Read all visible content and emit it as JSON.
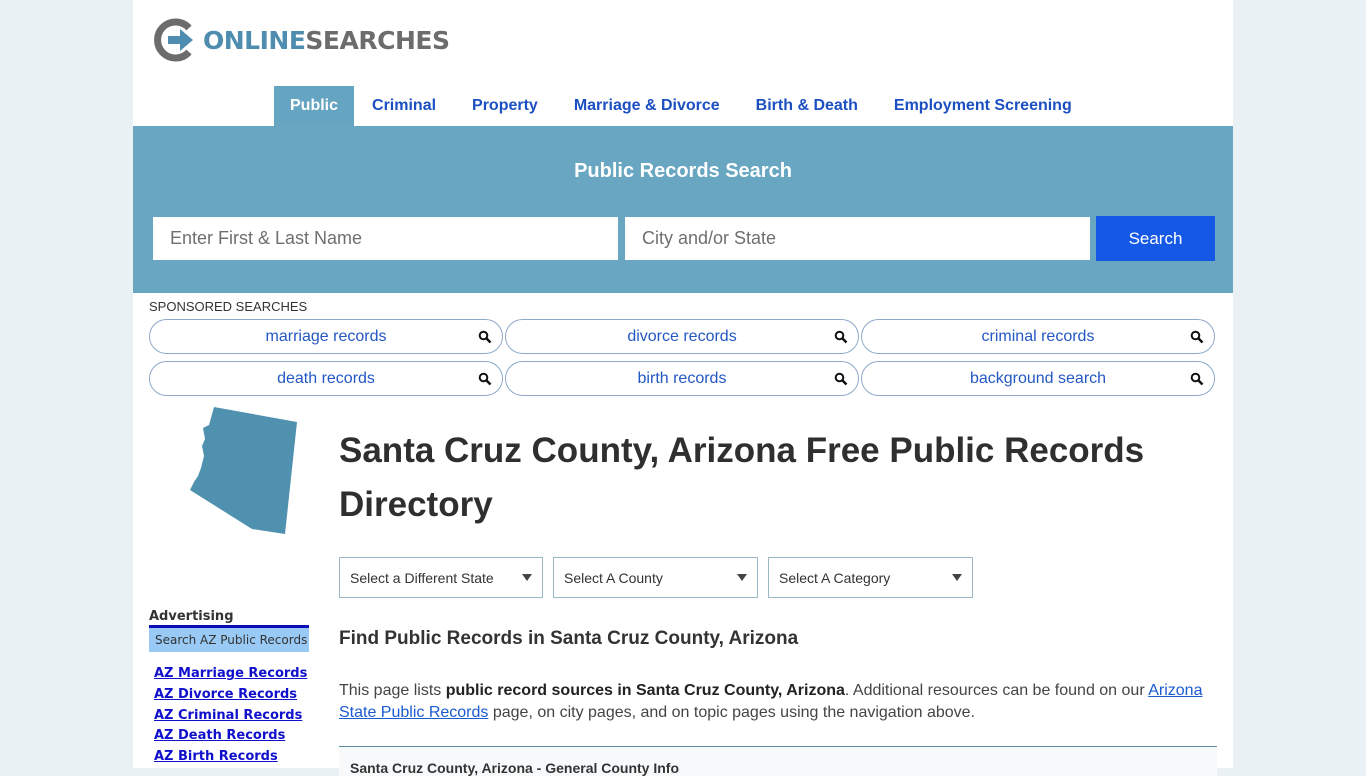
{
  "brand": {
    "part1": "ONLINE",
    "part2": "SEARCHES"
  },
  "nav": {
    "items": [
      {
        "label": "Public",
        "active": true
      },
      {
        "label": "Criminal"
      },
      {
        "label": "Property"
      },
      {
        "label": "Marriage & Divorce"
      },
      {
        "label": "Birth & Death"
      },
      {
        "label": "Employment Screening"
      }
    ]
  },
  "hero": {
    "title": "Public Records Search",
    "name_placeholder": "Enter First & Last Name",
    "location_placeholder": "City and/or State",
    "search_label": "Search"
  },
  "sponsored": {
    "label": "SPONSORED SEARCHES",
    "items": [
      "marriage records",
      "divorce records",
      "criminal records",
      "death records",
      "birth records",
      "background search"
    ]
  },
  "main": {
    "title": "Santa Cruz County, Arizona Free Public Records Directory",
    "selects": [
      "Select a Different State",
      "Select A County",
      "Select A Category"
    ],
    "subheading": "Find Public Records in Santa Cruz County, Arizona",
    "intro": {
      "pre": "This page lists ",
      "bold": "public record sources in Santa Cruz County, Arizona",
      "mid": ". Additional resources can be found on our ",
      "link": "Arizona State Public Records",
      "post": " page, on city pages, and on topic pages using the navigation above."
    },
    "section_title": "Santa Cruz County, Arizona - General County Info"
  },
  "sidebar": {
    "advertising_label": "Advertising",
    "ad_box": "Search AZ Public Records",
    "links": [
      "AZ Marriage Records",
      "AZ Divorce Records",
      "AZ Criminal Records",
      "AZ Death Records",
      "AZ Birth Records"
    ]
  }
}
